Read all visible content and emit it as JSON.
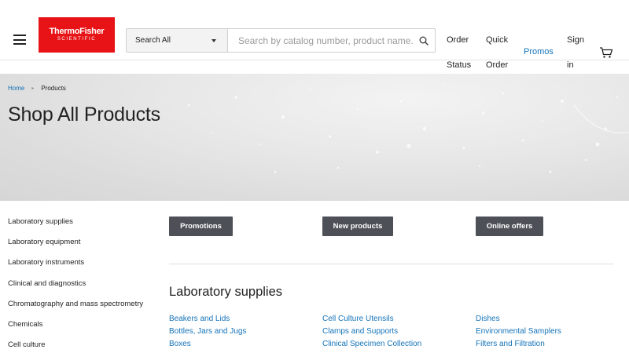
{
  "header": {
    "logo_line1": "ThermoFisher",
    "logo_line2": "SCIENTIFIC",
    "search_scope": "Search All",
    "search_placeholder": "Search by catalog number, product name...",
    "nav": {
      "order_status_1": "Order",
      "order_status_2": "Status",
      "quick_order_1": "Quick",
      "quick_order_2": "Order",
      "promos": "Promos",
      "sign_in_1": "Sign",
      "sign_in_2": "in"
    }
  },
  "breadcrumb": {
    "home": "Home",
    "current": "Products"
  },
  "hero": {
    "title": "Shop All Products"
  },
  "sidebar": {
    "items": [
      "Laboratory supplies",
      "Laboratory equipment",
      "Laboratory instruments",
      "Clinical and diagnostics",
      "Chromatography and mass spectrometry",
      "Chemicals",
      "Cell culture"
    ]
  },
  "buttons": {
    "promotions": "Promotions",
    "new_products": "New products",
    "online_offers": "Online offers"
  },
  "section": {
    "title": "Laboratory supplies",
    "columns": [
      [
        "Beakers and Lids",
        "Bottles, Jars and Jugs",
        "Boxes"
      ],
      [
        "Cell Culture Utensils",
        "Clamps and Supports",
        "Clinical Specimen Collection"
      ],
      [
        "Dishes",
        "Environmental Samplers",
        "Filters and Filtration"
      ]
    ]
  },
  "colors": {
    "brand_red": "#e71316",
    "link_blue": "#1473b9",
    "button_gray": "#4d5157"
  },
  "icons": [
    "menu-icon",
    "chevron-down-icon",
    "search-icon",
    "cart-icon",
    "chevron-right-icon"
  ]
}
